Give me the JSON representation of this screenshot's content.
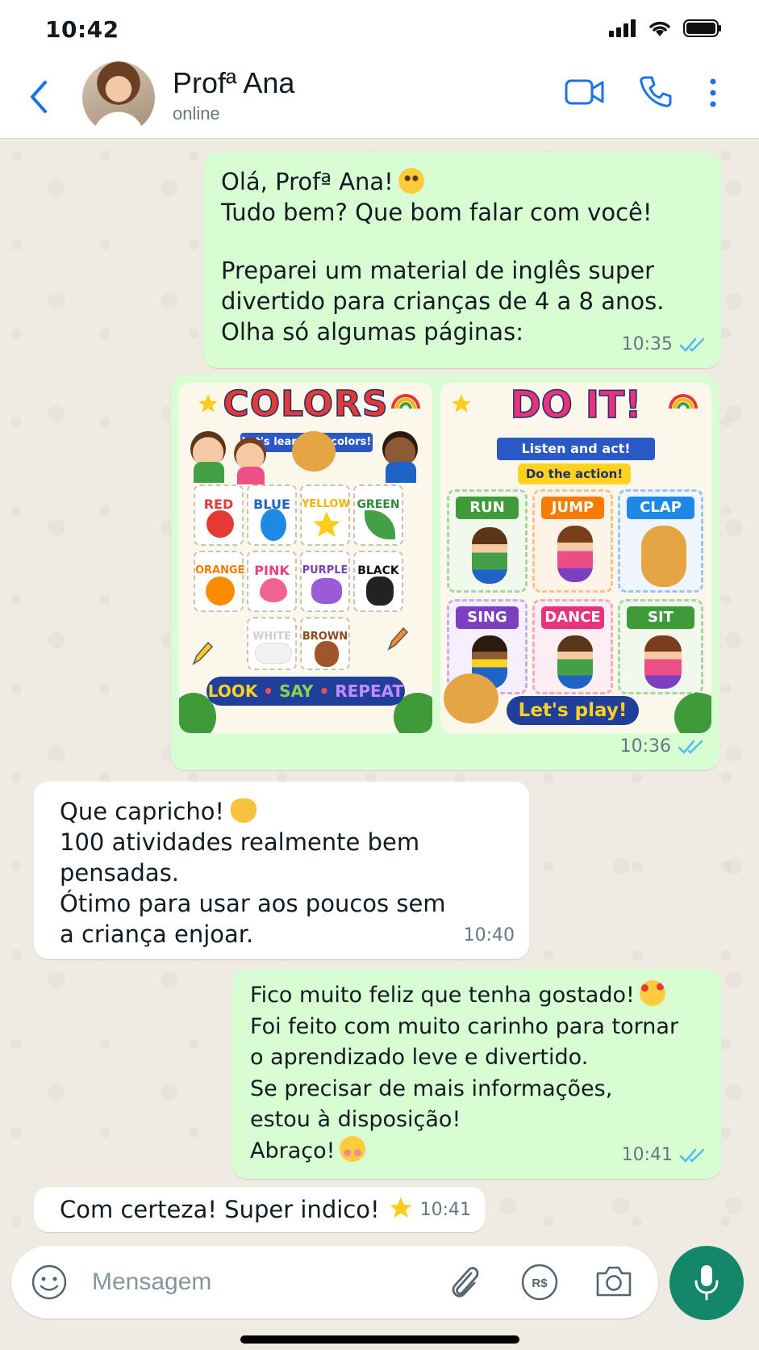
{
  "status_bar": {
    "time": "10:42"
  },
  "header": {
    "name": "Profª Ana",
    "status": "online"
  },
  "messages": {
    "m1": {
      "lines": [
        "Olá, Profª Ana!",
        "Tudo bem? Que bom falar com você!",
        "Preparei um material de inglês super",
        "divertido para crianças de 4 a 8 anos.",
        "Olha só algumas páginas:"
      ],
      "time": "10:35"
    },
    "m2": {
      "time": "10:36",
      "card1": {
        "title": "COLORS",
        "subtitle": "Let's learn the colors!",
        "colors": [
          "RED",
          "BLUE",
          "YELLOW",
          "GREEN",
          "ORANGE",
          "PINK",
          "PURPLE",
          "BLACK",
          "WHITE",
          "BROWN"
        ],
        "footer": [
          "LOOK",
          "•",
          "SAY",
          "•",
          "REPEAT"
        ]
      },
      "card2": {
        "title": "DO IT!",
        "subtitle": "Listen and act!",
        "tag": "Do the action!",
        "actions": [
          "RUN",
          "JUMP",
          "CLAP",
          "SING",
          "DANCE",
          "SIT"
        ],
        "footer": "Let's play!"
      }
    },
    "m3": {
      "lines": [
        "Que capricho!",
        "100 atividades realmente bem",
        "pensadas.",
        "Ótimo para usar aos poucos sem",
        "a criança enjoar."
      ],
      "time": "10:40"
    },
    "m4": {
      "lines": [
        "Fico muito feliz que tenha gostado!",
        "Foi feito com muito carinho para tornar",
        "o aprendizado leve e divertido.",
        "Se precisar de mais informações,",
        "estou à disposição!",
        "Abraço!"
      ],
      "time": "10:41"
    },
    "m5": {
      "text": "Com certeza! Super indico!",
      "time": "10:41"
    }
  },
  "composer": {
    "placeholder": "Mensagem"
  },
  "colors": {
    "accent": "#1a73e8",
    "outgoing": "#d9fdd3",
    "incoming": "#ffffff",
    "mic": "#14876a",
    "tick": "#53bdeb"
  }
}
